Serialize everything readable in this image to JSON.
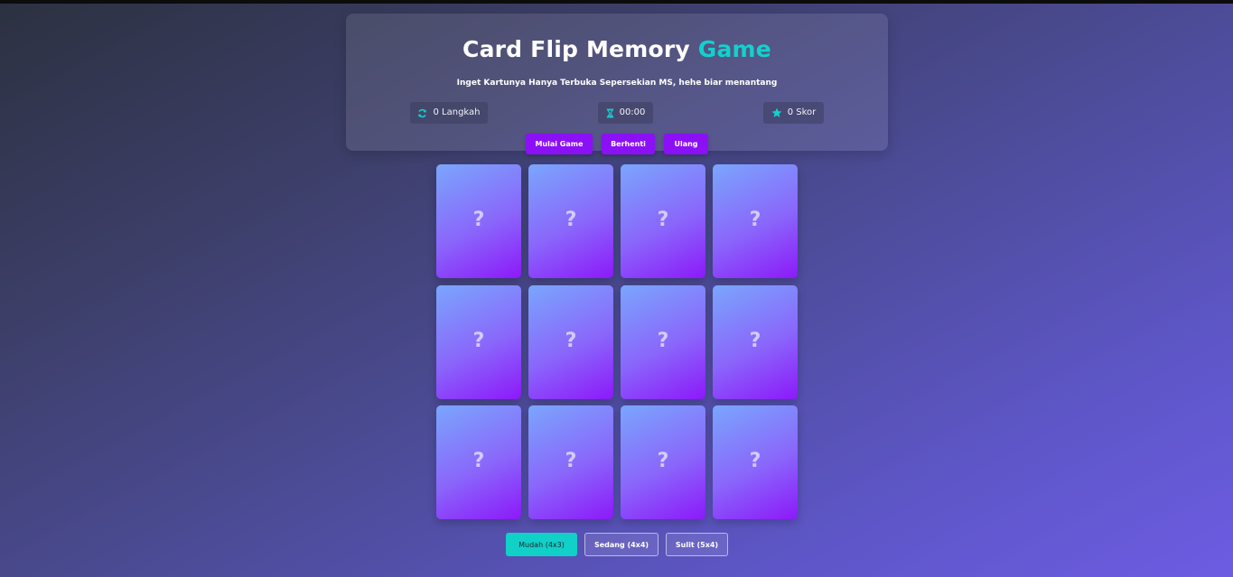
{
  "header": {
    "title_main": "Card Flip Memory ",
    "title_accent": "Game",
    "subtitle": "Inget Kartunya Hanya Terbuka Sepersekian MS, hehe biar menantang"
  },
  "stats": {
    "moves": {
      "icon": "sync-icon",
      "label": "0 Langkah"
    },
    "time": {
      "icon": "hourglass-icon",
      "label": "00:00"
    },
    "score": {
      "icon": "star-icon",
      "label": "0 Skor"
    }
  },
  "controls": {
    "start_label": "Mulai Game",
    "stop_label": "Berhenti",
    "reset_label": "Ulang"
  },
  "board": {
    "rows": 3,
    "cols": 4,
    "cards": [
      {
        "face": "?"
      },
      {
        "face": "?"
      },
      {
        "face": "?"
      },
      {
        "face": "?"
      },
      {
        "face": "?"
      },
      {
        "face": "?"
      },
      {
        "face": "?"
      },
      {
        "face": "?"
      },
      {
        "face": "?"
      },
      {
        "face": "?"
      },
      {
        "face": "?"
      },
      {
        "face": "?"
      }
    ]
  },
  "difficulty": {
    "easy_label": "Mudah (4x3)",
    "medium_label": "Sedang (4x4)",
    "hard_label": "Sulit (5x4)",
    "selected": "easy"
  },
  "colors": {
    "accent": "#12d1cc",
    "button": "#8b10f6",
    "card_top": "#7aa6fd",
    "card_bottom": "#8c19fa"
  }
}
